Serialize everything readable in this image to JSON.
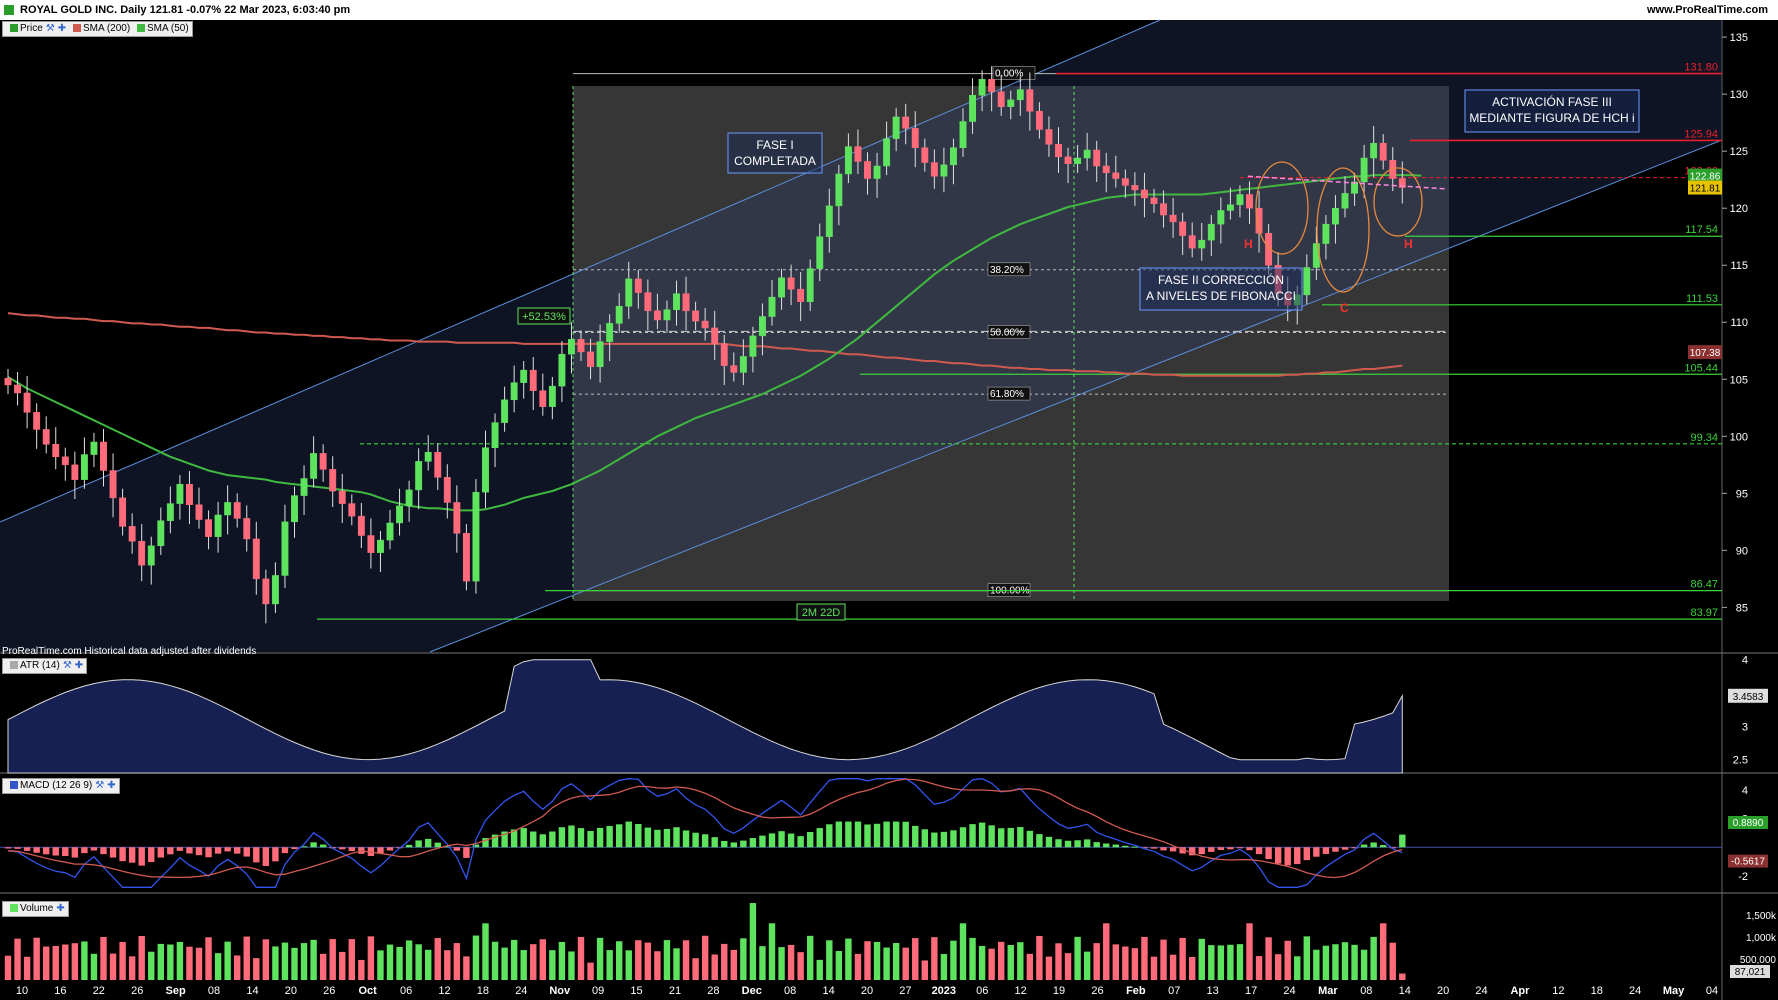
{
  "header": {
    "title": "ROYAL GOLD INC. Daily 121.81 -0.07% 22 Mar 2023, 6:03:40 pm",
    "website": "www.ProRealTime.com"
  },
  "panels": {
    "price_legend": {
      "label": "Price",
      "sma200": "SMA (200)",
      "sma50": "SMA (50)"
    },
    "atr_legend": "ATR (14)",
    "macd_legend": "MACD (12 26 9)",
    "volume_legend": "Volume",
    "source_note": "ProRealTime.com Historical data adjusted after dividends"
  },
  "colors": {
    "background": "#000000",
    "up_candle": "#5ee35e",
    "down_candle": "#ff6b7a",
    "sma200": "#d05a50",
    "sma50": "#3fb93f",
    "channel": "#5b8fd9",
    "support": "#3cd23c",
    "resistance": "#e8202a"
  },
  "chart_data": {
    "type": "candlestick",
    "x_axis_labels": [
      "10",
      "16",
      "22",
      "26",
      "Sep",
      "08",
      "14",
      "20",
      "26",
      "Oct",
      "06",
      "12",
      "18",
      "24",
      "Nov",
      "09",
      "15",
      "21",
      "28",
      "Dec",
      "08",
      "14",
      "20",
      "27",
      "2023",
      "06",
      "12",
      "19",
      "26",
      "Feb",
      "07",
      "13",
      "17",
      "24",
      "Mar",
      "08",
      "14",
      "20",
      "24",
      "Apr",
      "12",
      "18",
      "24",
      "May",
      "04"
    ],
    "price_axis": {
      "min": 81,
      "max": 136.5,
      "ticks": [
        85,
        90,
        95,
        100,
        105,
        110,
        115,
        120,
        125,
        130,
        135
      ]
    },
    "levels": {
      "resistance": [
        131.8,
        125.94,
        122.68
      ],
      "support": [
        117.54,
        111.53,
        105.44,
        99.34,
        86.47,
        83.97
      ],
      "current": 121.81,
      "sma200_last": 107.38,
      "sma50_last": 122.86
    },
    "fibonacci": [
      {
        "label": "0.00%",
        "price": 131.8
      },
      {
        "label": "38.20%",
        "price": 114.6
      },
      {
        "label": "50.00%",
        "price": 109.1
      },
      {
        "label": "61.80%",
        "price": 103.7
      },
      {
        "label": "100.00%",
        "price": 86.47
      }
    ],
    "annotations": {
      "gain": "+52.53%",
      "duration": "2M 22D",
      "phase1": [
        "FASE I",
        "COMPLETADA"
      ],
      "phase2": [
        "FASE II CORRECCIÓN",
        "A  NIVELES DE FIBONACCI"
      ],
      "phase3": [
        "ACTIVACIÓN FASE III",
        "MEDIANTE FIGURA DE HCH i"
      ],
      "hch_left": "H",
      "hch_head": "C",
      "hch_right": "H"
    },
    "closes": [
      104.5,
      103.8,
      102.1,
      100.6,
      99.3,
      98.2,
      97.5,
      96.2,
      98.4,
      99.5,
      97.0,
      94.6,
      92.1,
      90.8,
      88.7,
      90.4,
      92.6,
      94.1,
      95.8,
      94.0,
      92.7,
      91.2,
      93.1,
      94.2,
      92.8,
      91.0,
      87.5,
      85.3,
      87.8,
      92.5,
      94.8,
      96.3,
      98.5,
      97.1,
      95.2,
      94.1,
      93.0,
      91.3,
      89.8,
      90.9,
      92.4,
      93.9,
      95.3,
      97.8,
      98.6,
      96.4,
      94.2,
      91.5,
      87.3,
      95.1,
      99.0,
      101.2,
      103.2,
      104.7,
      105.8,
      104.0,
      102.6,
      104.4,
      107.2,
      108.5,
      107.4,
      106.1,
      108.3,
      109.9,
      111.4,
      113.8,
      112.6,
      111.0,
      110.2,
      111.1,
      112.5,
      111.0,
      110.1,
      109.5,
      108.1,
      106.2,
      105.6,
      107.0,
      108.8,
      110.5,
      112.2,
      113.9,
      112.9,
      111.8,
      114.7,
      117.5,
      120.2,
      123.0,
      125.4,
      124.1,
      122.6,
      123.7,
      126.1,
      128.0,
      127.0,
      125.3,
      124.0,
      122.8,
      123.8,
      125.3,
      127.6,
      129.9,
      131.3,
      130.2,
      128.9,
      129.5,
      130.4,
      128.5,
      126.9,
      125.6,
      124.5,
      123.9,
      124.4,
      125.1,
      123.7,
      123.1,
      122.6,
      122.0,
      121.6,
      120.9,
      120.4,
      119.4,
      118.8,
      117.6,
      116.5,
      117.2,
      118.6,
      119.8,
      120.3,
      121.2,
      120.0,
      117.8,
      115.0,
      112.5,
      111.5,
      112.4,
      114.8,
      116.9,
      118.6,
      120.0,
      121.3,
      122.3,
      124.4,
      125.7,
      124.2,
      122.6,
      121.81
    ],
    "sma200": [
      110.8,
      110.7,
      110.6,
      110.6,
      110.5,
      110.4,
      110.4,
      110.3,
      110.3,
      110.2,
      110.1,
      110.1,
      110.0,
      109.9,
      109.9,
      109.8,
      109.8,
      109.7,
      109.6,
      109.6,
      109.5,
      109.5,
      109.4,
      109.3,
      109.3,
      109.2,
      109.1,
      109.1,
      109.0,
      109.0,
      108.9,
      108.9,
      108.8,
      108.8,
      108.7,
      108.7,
      108.6,
      108.6,
      108.5,
      108.5,
      108.4,
      108.4,
      108.4,
      108.3,
      108.3,
      108.3,
      108.3,
      108.2,
      108.2,
      108.2,
      108.2,
      108.2,
      108.2,
      108.2,
      108.1,
      108.1,
      108.1,
      108.1,
      108.1,
      108.1,
      108.1,
      108.1,
      108.1,
      108.1,
      108.1,
      108.1,
      108.1,
      108.1,
      108.1,
      108.1,
      108.1,
      108.1,
      108.1,
      108.1,
      108.1,
      108.1,
      108.0,
      107.9,
      107.9,
      107.9,
      107.8,
      107.7,
      107.7,
      107.6,
      107.5,
      107.5,
      107.4,
      107.3,
      107.2,
      107.2,
      107.1,
      107.0,
      106.9,
      106.9,
      106.8,
      106.7,
      106.6,
      106.6,
      106.5,
      106.4,
      106.4,
      106.3,
      106.2,
      106.2,
      106.1,
      106.0,
      106.0,
      105.9,
      105.9,
      105.8,
      105.8,
      105.8,
      105.7,
      105.7,
      105.7,
      105.6,
      105.6,
      105.5,
      105.5,
      105.5,
      105.4,
      105.4,
      105.4,
      105.3,
      105.3,
      105.3,
      105.3,
      105.3,
      105.3,
      105.3,
      105.3,
      105.3,
      105.3,
      105.3,
      105.4,
      105.4,
      105.5,
      105.5,
      105.6,
      105.6,
      105.7,
      105.8,
      105.9,
      105.9,
      106.0,
      106.1,
      106.2
    ],
    "sma50": [
      105.2,
      104.7,
      104.2,
      103.8,
      103.4,
      103.0,
      102.6,
      102.2,
      101.8,
      101.4,
      101.0,
      100.6,
      100.2,
      99.8,
      99.4,
      99.0,
      98.6,
      98.2,
      97.9,
      97.6,
      97.3,
      97.0,
      96.8,
      96.6,
      96.5,
      96.4,
      96.3,
      96.2,
      96.0,
      95.9,
      95.8,
      95.7,
      95.6,
      95.5,
      95.4,
      95.3,
      95.2,
      95.1,
      94.9,
      94.6,
      94.3,
      94.1,
      93.9,
      93.8,
      93.7,
      93.7,
      93.6,
      93.5,
      93.5,
      93.5,
      93.6,
      93.8,
      94.0,
      94.3,
      94.6,
      94.8,
      95.0,
      95.2,
      95.5,
      95.8,
      96.2,
      96.6,
      97.0,
      97.5,
      98.0,
      98.5,
      99.0,
      99.5,
      100.0,
      100.4,
      100.8,
      101.2,
      101.6,
      101.9,
      102.2,
      102.5,
      102.8,
      103.1,
      103.4,
      103.7,
      104.1,
      104.5,
      104.9,
      105.3,
      105.8,
      106.3,
      106.8,
      107.4,
      108.0,
      108.6,
      109.3,
      110.0,
      110.7,
      111.4,
      112.1,
      112.8,
      113.5,
      114.2,
      114.8,
      115.4,
      115.9,
      116.4,
      116.9,
      117.4,
      117.8,
      118.2,
      118.6,
      118.9,
      119.2,
      119.5,
      119.8,
      120.1,
      120.3,
      120.5,
      120.7,
      120.9,
      121.0,
      121.1,
      121.2,
      121.2,
      121.2,
      121.2,
      121.2,
      121.2,
      121.2,
      121.2,
      121.3,
      121.4,
      121.5,
      121.6,
      121.7,
      121.8,
      121.9,
      122.0,
      122.1,
      122.2,
      122.3,
      122.4,
      122.5,
      122.6,
      122.7,
      122.8,
      122.8,
      122.9,
      122.9,
      122.9,
      122.9,
      122.9,
      122.86
    ],
    "atr": {
      "axis_ticks": [
        2.5,
        3,
        3.5,
        4
      ],
      "last": 3.4583
    },
    "macd": {
      "axis_ticks": [
        4,
        2,
        -2
      ],
      "last_histogram": 0.889,
      "last_signal": -0.5617
    },
    "volume": {
      "axis_ticks": [
        "1,500k",
        "1,000k",
        "500,000"
      ],
      "last": "87,021"
    }
  }
}
